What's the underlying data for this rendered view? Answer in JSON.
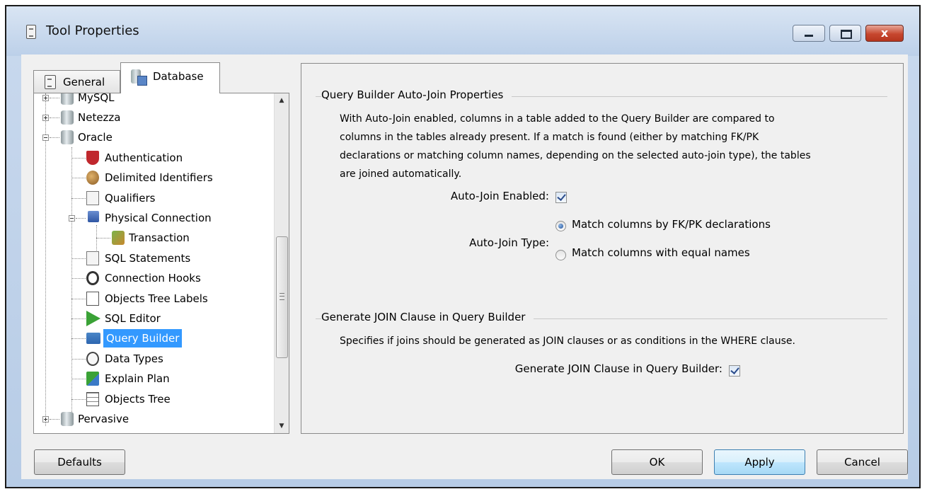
{
  "window": {
    "title": "Tool Properties",
    "controls": {
      "minimize": "minimize",
      "maximize": "maximize",
      "close": "x"
    }
  },
  "tabs": [
    {
      "label": "General",
      "icon": "general-tab-icon",
      "selected": false
    },
    {
      "label": "Database",
      "icon": "database-tab-icon",
      "selected": true
    }
  ],
  "tree": {
    "items": [
      {
        "label": "MySQL",
        "icon": "database-icon",
        "expander": "plus"
      },
      {
        "label": "Netezza",
        "icon": "database-icon",
        "expander": "plus"
      },
      {
        "label": "Oracle",
        "icon": "database-icon",
        "expander": "minus"
      },
      {
        "label": "Authentication",
        "icon": "shield-icon"
      },
      {
        "label": "Delimited Identifiers",
        "icon": "delimiter-icon"
      },
      {
        "label": "Qualifiers",
        "icon": "qualifiers-icon"
      },
      {
        "label": "Physical Connection",
        "icon": "connection-icon",
        "expander": "minus"
      },
      {
        "label": "Transaction",
        "icon": "transaction-icon"
      },
      {
        "label": "SQL Statements",
        "icon": "document-icon"
      },
      {
        "label": "Connection Hooks",
        "icon": "hook-icon"
      },
      {
        "label": "Objects Tree Labels",
        "icon": "labels-icon"
      },
      {
        "label": "SQL Editor",
        "icon": "play-icon"
      },
      {
        "label": "Query Builder",
        "icon": "query-builder-icon",
        "selected": true
      },
      {
        "label": "Data Types",
        "icon": "data-types-icon"
      },
      {
        "label": "Explain Plan",
        "icon": "explain-plan-icon"
      },
      {
        "label": "Objects Tree",
        "icon": "objects-tree-icon"
      },
      {
        "label": "Pervasive",
        "icon": "database-icon",
        "expander": "plus"
      }
    ]
  },
  "autojoin": {
    "group_title": "Query Builder Auto-Join Properties",
    "description_lines": [
      "With Auto-Join enabled, columns in a table added to the Query Builder are compared to",
      "columns in the tables already present. If a match is found (either by matching FK/PK",
      "declarations or matching column names, depending on the selected auto-join type), the tables",
      "are joined automatically."
    ],
    "enabled_label": "Auto-Join Enabled:",
    "enabled_checked": true,
    "type_label": "Auto-Join Type:",
    "options": [
      {
        "label": "Match columns by FK/PK declarations",
        "selected": true
      },
      {
        "label": "Match columns with equal names",
        "selected": false
      }
    ]
  },
  "join_clause": {
    "group_title": "Generate JOIN Clause in Query Builder",
    "description": "Specifies if joins should be generated as JOIN clauses or as conditions in the WHERE clause.",
    "checkbox_label": "Generate JOIN Clause in Query Builder:",
    "checked": true
  },
  "buttons": {
    "defaults": "Defaults",
    "ok": "OK",
    "apply": "Apply",
    "cancel": "Cancel"
  }
}
